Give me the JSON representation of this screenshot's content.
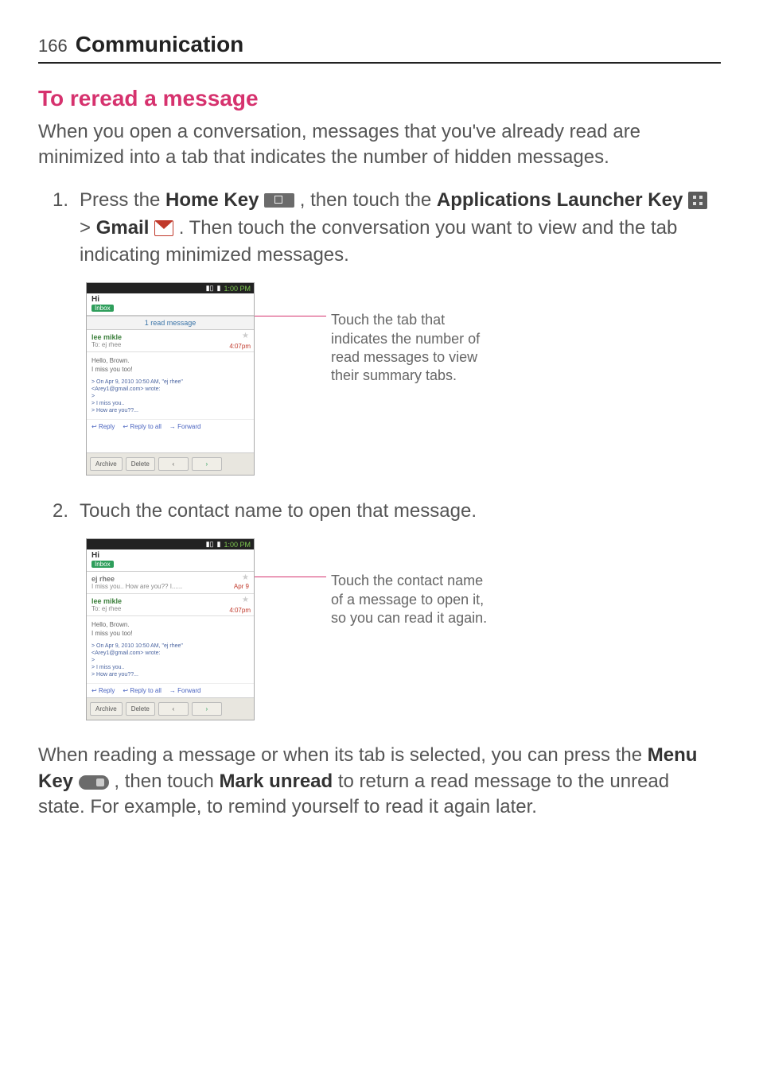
{
  "header": {
    "page_number": "166",
    "chapter": "Communication"
  },
  "section": {
    "title": "To reread a message",
    "intro": "When you open a conversation, messages that you've already read are minimized into a tab that indicates the number of hidden messages."
  },
  "steps": {
    "s1": {
      "num": "1.",
      "t1": "Press the ",
      "home_key": "Home Key",
      "t2": " , then touch the ",
      "applications": "Applications Launcher Key",
      "t3": " > ",
      "gmail": "Gmail",
      "t4": ". Then touch the conversation you want to view and the tab indicating minimized messages."
    },
    "s2": {
      "num": "2.",
      "text": "Touch the contact name to open that message."
    }
  },
  "captions": {
    "c1": "Touch the tab that indicates the number of read messages to view their summary tabs.",
    "c2": "Touch the contact name of a message to open it, so you can read it again."
  },
  "footer": {
    "t1": "When reading a message or when its tab is selected, you can press the ",
    "menu_key": "Menu Key",
    "t2": " , then touch ",
    "mark_unread": "Mark unread",
    "t3": " to return a read message to the unread state. For example, to remind yourself to read it again later."
  },
  "screenshot": {
    "time": "1:00 PM",
    "subject": "Hi",
    "label": "Inbox",
    "read_tab": "1 read message",
    "sender_green": "lee mikle",
    "to_line": "To: ej rhee",
    "msg_ts": "4:07pm",
    "body_line1": "Hello, Brown.",
    "body_line2": "I miss you too!",
    "quote_line1": "> On Apr 9, 2010 10:50 AM, \"ej rhee\"",
    "quote_line2": "<Arey1@gmail.com> wrote:",
    "quote_line3": "> I miss you..",
    "quote_line4": "> How are you??...",
    "reply": "Reply",
    "reply_all": "Reply to all",
    "forward": "Forward",
    "archive": "Archive",
    "delete": "Delete",
    "thread_sender": "ej rhee",
    "thread_snippet": "I miss you.. How are you?? I......",
    "thread_date": "Apr 9"
  }
}
